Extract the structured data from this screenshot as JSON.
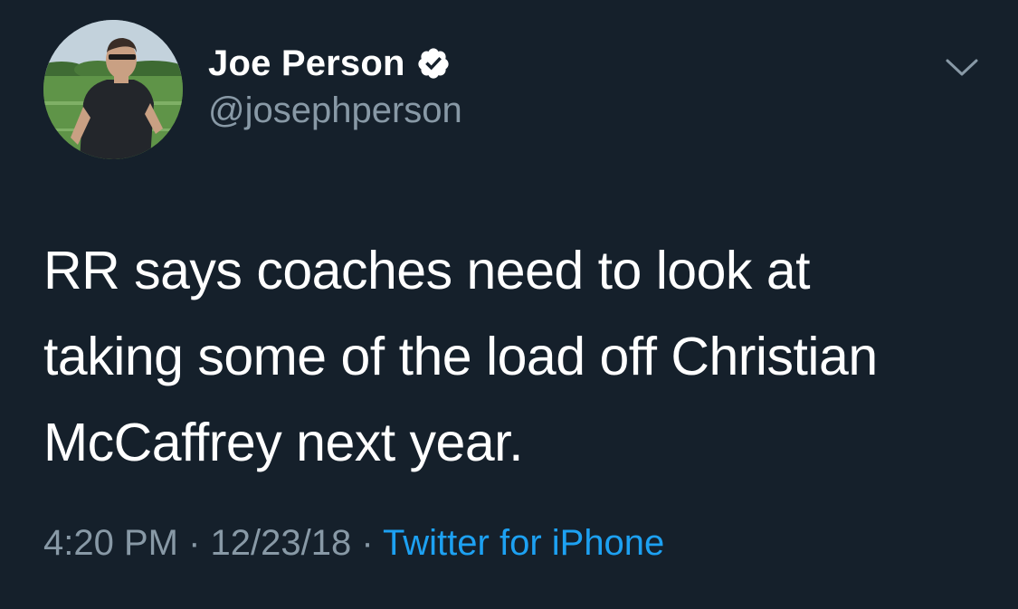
{
  "author": {
    "display_name": "Joe Person",
    "handle": "@josephperson",
    "verified": true
  },
  "tweet": {
    "text_lines": [
      "RR says coaches need to look at",
      "taking some of the load off Christian",
      "McCaffrey next year."
    ]
  },
  "meta": {
    "time": "4:20 PM",
    "separator": " · ",
    "date": "12/23/18",
    "source": "Twitter for iPhone"
  },
  "icons": {
    "verified": "verified-badge-icon",
    "menu": "chevron-down-icon"
  },
  "colors": {
    "background": "#15202b",
    "text_primary": "#ffffff",
    "text_secondary": "#8899a6",
    "link": "#1da1f2"
  }
}
